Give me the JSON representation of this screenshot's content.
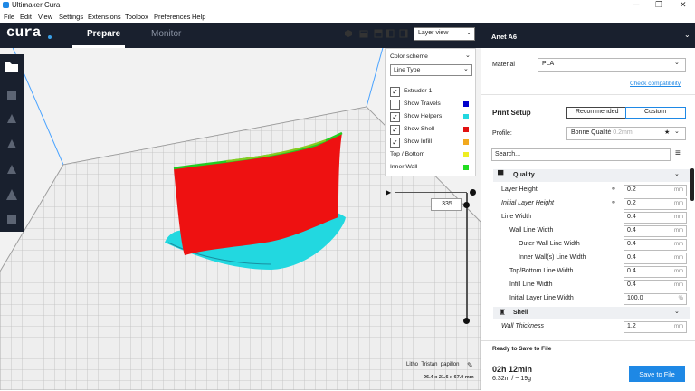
{
  "window": {
    "title": "Ultimaker Cura",
    "minimize": "─",
    "maximize": "❐",
    "close": "✕"
  },
  "menu": [
    "File",
    "Edit",
    "View",
    "Settings",
    "Extensions",
    "Toolbox",
    "Preferences",
    "Help"
  ],
  "header": {
    "logo": "cura",
    "tabs": [
      "Prepare",
      "Monitor"
    ],
    "active_tab": "Prepare",
    "machine": "Anet A6"
  },
  "viewport": {
    "view_mode": "Layer view",
    "color_scheme": {
      "label": "Color scheme",
      "selected": "Line Type",
      "items": [
        {
          "label": "Extruder 1",
          "checked": true,
          "color": ""
        },
        {
          "label": "Show Travels",
          "checked": false,
          "color": "#0000cc"
        },
        {
          "label": "Show Helpers",
          "checked": true,
          "color": "#22d8e0"
        },
        {
          "label": "Show Shell",
          "checked": true,
          "color": "#e11111"
        },
        {
          "label": "Show Infill",
          "checked": true,
          "color": "#f2a91e"
        },
        {
          "label": "Top / Bottom",
          "checked": null,
          "color": "#eeee22"
        },
        {
          "label": "Inner Wall",
          "checked": null,
          "color": "#22dd22"
        }
      ]
    },
    "layer_number": ".335",
    "model_name": "Litho_Tristan_papillon",
    "model_dims": "96.4 x 21.6 x 67.0 mm"
  },
  "material": {
    "label": "Material",
    "value": "PLA",
    "check": "Check compatibility"
  },
  "print_setup": {
    "title": "Print Setup",
    "mode_recommended": "Recommended",
    "mode_custom": "Custom",
    "profile_label": "Profile:",
    "profile_value": "Bonne Qualité",
    "profile_suffix": " - 0.2mm",
    "search_placeholder": "Search...",
    "categories": [
      {
        "name": "Quality",
        "settings": [
          {
            "label": "Layer Height",
            "value": "0.2",
            "unit": "mm",
            "italic": false,
            "link": true,
            "indent": 0
          },
          {
            "label": "Initial Layer Height",
            "value": "0.2",
            "unit": "mm",
            "italic": true,
            "link": true,
            "indent": 0
          },
          {
            "label": "Line Width",
            "value": "0.4",
            "unit": "mm",
            "italic": false,
            "link": false,
            "indent": 0
          },
          {
            "label": "Wall Line Width",
            "value": "0.4",
            "unit": "mm",
            "italic": false,
            "link": false,
            "indent": 1
          },
          {
            "label": "Outer Wall Line Width",
            "value": "0.4",
            "unit": "mm",
            "italic": false,
            "link": false,
            "indent": 2
          },
          {
            "label": "Inner Wall(s) Line Width",
            "value": "0.4",
            "unit": "mm",
            "italic": false,
            "link": false,
            "indent": 2
          },
          {
            "label": "Top/Bottom Line Width",
            "value": "0.4",
            "unit": "mm",
            "italic": false,
            "link": false,
            "indent": 1
          },
          {
            "label": "Infill Line Width",
            "value": "0.4",
            "unit": "mm",
            "italic": false,
            "link": false,
            "indent": 1
          },
          {
            "label": "Initial Layer Line Width",
            "value": "100.0",
            "unit": "%",
            "italic": false,
            "link": false,
            "indent": 1
          }
        ]
      },
      {
        "name": "Shell",
        "settings": [
          {
            "label": "Wall Thickness",
            "value": "1.2",
            "unit": "mm",
            "italic": true,
            "link": false,
            "indent": 0
          }
        ]
      }
    ]
  },
  "bottom": {
    "ready": "Ready to Save to File",
    "time": "02h 12min",
    "material_used": "6.32m / ~ 19g",
    "save_button": "Save to File"
  }
}
